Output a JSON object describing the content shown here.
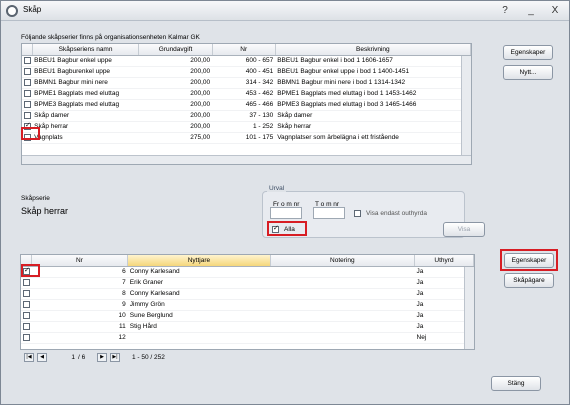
{
  "window": {
    "title": "Skåp",
    "help": "?",
    "minimize": "_",
    "close": "X"
  },
  "top_caption": "Följande skåpserier finns på organisationsenheten Kalmar GK",
  "series_table": {
    "headers": [
      "Skåpseriens namn",
      "Grundavgift",
      "Nr",
      "Beskrivning"
    ],
    "rows": [
      {
        "checked": false,
        "name": "BBEU1 Bagbur enkel uppe",
        "fee": "200,00",
        "nr": "600 - 657",
        "desc": "BBEU1 Bagbur enkel i bod 1 1606-1657"
      },
      {
        "checked": false,
        "name": "BBEU1 Bagburenkel uppe",
        "fee": "200,00",
        "nr": "400 - 451",
        "desc": "BBEU1 Bagbur enkel uppe i bod 1 1400-1451"
      },
      {
        "checked": false,
        "name": "BBMN1 Bagbur mini nere",
        "fee": "200,00",
        "nr": "314 - 342",
        "desc": "BBMN1 Bagbur mini nere i bod 1 1314-1342"
      },
      {
        "checked": false,
        "name": "BPME1 Bagplats med eluttag",
        "fee": "200,00",
        "nr": "453 - 462",
        "desc": "BPME1 Bagplats med eluttag i bod 1 1453-1462"
      },
      {
        "checked": false,
        "name": "BPME3 Bagplats med eluttag",
        "fee": "200,00",
        "nr": "465 - 466",
        "desc": "BPME3 Bagplats med eluttag i bod 3 1465-1466"
      },
      {
        "checked": false,
        "name": "Skåp damer",
        "fee": "200,00",
        "nr": "37 - 130",
        "desc": "Skåp damer"
      },
      {
        "checked": true,
        "name": "Skåp herrar",
        "fee": "200,00",
        "nr": "1 - 252",
        "desc": "Skåp herrar"
      },
      {
        "checked": false,
        "name": "Vagnplats",
        "fee": "275,00",
        "nr": "101 - 175",
        "desc": "Vagnplatser som ärbelägna i ett fristående"
      }
    ]
  },
  "buttons": {
    "properties_top": "Egenskaper",
    "new": "Nytt...",
    "properties_bottom": "Egenskaper",
    "owners": "Skåpägare",
    "close": "Stäng",
    "show": "Visa"
  },
  "series": {
    "label": "Skåpserie",
    "value": "Skåp herrar"
  },
  "filter": {
    "group": "Urval",
    "from_label": "Fr o m nr",
    "to_label": "T o m nr",
    "only_unrented": "Visa endast outhyrda",
    "all": "Alla"
  },
  "locker_table": {
    "headers": [
      "Nr",
      "Nyttjare",
      "Notering",
      "Uthyrd"
    ],
    "rows": [
      {
        "checked": true,
        "nr": "6",
        "user": "Conny Karlesand",
        "note": "",
        "rented": "Ja"
      },
      {
        "checked": false,
        "nr": "7",
        "user": "Erik Graner",
        "note": "",
        "rented": "Ja"
      },
      {
        "checked": false,
        "nr": "8",
        "user": "Conny Karlesand",
        "note": "",
        "rented": "Ja"
      },
      {
        "checked": false,
        "nr": "9",
        "user": "Jimmy Grön",
        "note": "",
        "rented": "Ja"
      },
      {
        "checked": false,
        "nr": "10",
        "user": "Sune Berglund",
        "note": "",
        "rented": "Ja"
      },
      {
        "checked": false,
        "nr": "11",
        "user": "Stig Hård",
        "note": "",
        "rented": "Ja"
      },
      {
        "checked": false,
        "nr": "12",
        "user": "",
        "note": "",
        "rented": "Nej"
      }
    ]
  },
  "pager": {
    "page": "1",
    "of": "/ 6",
    "range": "1 - 50 / 252"
  }
}
